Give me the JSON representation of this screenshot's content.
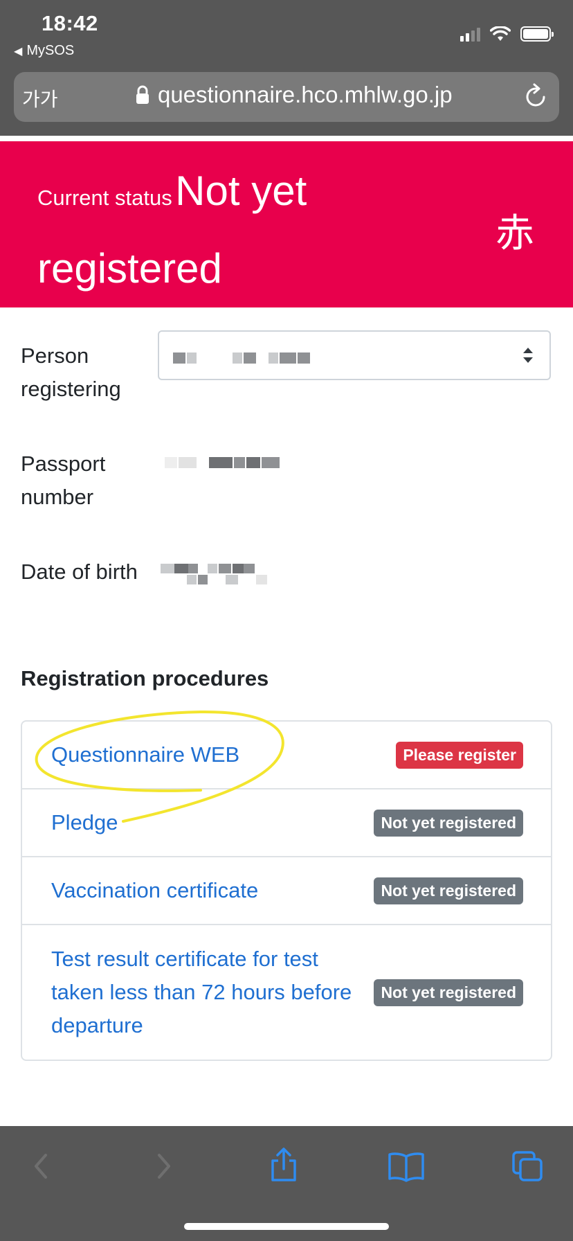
{
  "statusbar": {
    "time": "18:42",
    "back_app": "MySOS"
  },
  "browser": {
    "aa_label": "가가",
    "url": "questionnaire.hco.mhlw.go.jp"
  },
  "banner": {
    "label": "Current status",
    "value": "Not yet registered",
    "indicator": "赤",
    "color": "#e8004c"
  },
  "fields": {
    "person_label": "Person registering",
    "passport_label": "Passport number",
    "dob_label": "Date of birth"
  },
  "procedures": {
    "title": "Registration procedures",
    "items": [
      {
        "label": "Questionnaire WEB",
        "status": "Please register",
        "status_color": "#dc3545"
      },
      {
        "label": "Pledge",
        "status": "Not yet registered",
        "status_color": "#6c757d"
      },
      {
        "label": "Vaccination certificate",
        "status": "Not yet registered",
        "status_color": "#6c757d"
      },
      {
        "label": "Test result certificate for test taken less than 72 hours before departure",
        "status": "Not yet registered",
        "status_color": "#6c757d"
      }
    ]
  },
  "colors": {
    "link": "#1f6fd1",
    "annotation": "#f3e52e",
    "chrome": "#575757"
  },
  "icons": [
    "lock-icon",
    "reload-icon",
    "back-icon",
    "forward-icon",
    "share-icon",
    "bookmarks-icon",
    "tabs-icon",
    "select-arrows-icon",
    "wifi-icon",
    "signal-icon",
    "battery-icon"
  ]
}
